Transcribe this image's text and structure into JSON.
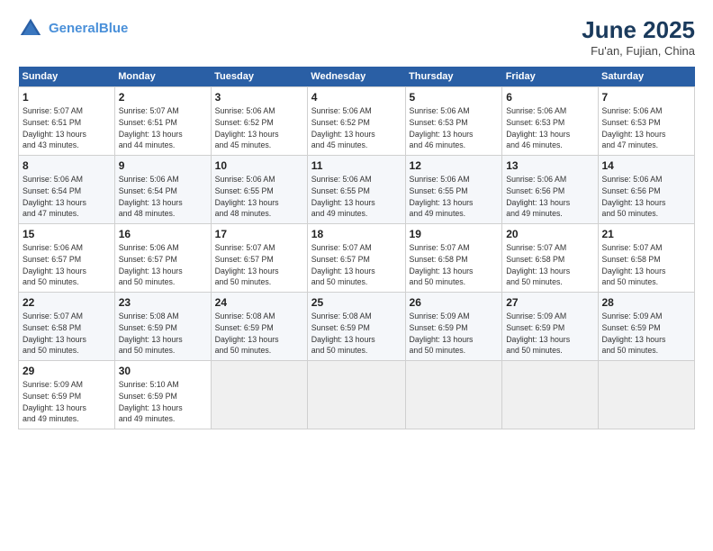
{
  "header": {
    "logo_line1": "General",
    "logo_line2": "Blue",
    "month": "June 2025",
    "location": "Fu'an, Fujian, China"
  },
  "weekdays": [
    "Sunday",
    "Monday",
    "Tuesday",
    "Wednesday",
    "Thursday",
    "Friday",
    "Saturday"
  ],
  "weeks": [
    [
      {
        "day": "1",
        "info": "Sunrise: 5:07 AM\nSunset: 6:51 PM\nDaylight: 13 hours\nand 43 minutes."
      },
      {
        "day": "2",
        "info": "Sunrise: 5:07 AM\nSunset: 6:51 PM\nDaylight: 13 hours\nand 44 minutes."
      },
      {
        "day": "3",
        "info": "Sunrise: 5:06 AM\nSunset: 6:52 PM\nDaylight: 13 hours\nand 45 minutes."
      },
      {
        "day": "4",
        "info": "Sunrise: 5:06 AM\nSunset: 6:52 PM\nDaylight: 13 hours\nand 45 minutes."
      },
      {
        "day": "5",
        "info": "Sunrise: 5:06 AM\nSunset: 6:53 PM\nDaylight: 13 hours\nand 46 minutes."
      },
      {
        "day": "6",
        "info": "Sunrise: 5:06 AM\nSunset: 6:53 PM\nDaylight: 13 hours\nand 46 minutes."
      },
      {
        "day": "7",
        "info": "Sunrise: 5:06 AM\nSunset: 6:53 PM\nDaylight: 13 hours\nand 47 minutes."
      }
    ],
    [
      {
        "day": "8",
        "info": "Sunrise: 5:06 AM\nSunset: 6:54 PM\nDaylight: 13 hours\nand 47 minutes."
      },
      {
        "day": "9",
        "info": "Sunrise: 5:06 AM\nSunset: 6:54 PM\nDaylight: 13 hours\nand 48 minutes."
      },
      {
        "day": "10",
        "info": "Sunrise: 5:06 AM\nSunset: 6:55 PM\nDaylight: 13 hours\nand 48 minutes."
      },
      {
        "day": "11",
        "info": "Sunrise: 5:06 AM\nSunset: 6:55 PM\nDaylight: 13 hours\nand 49 minutes."
      },
      {
        "day": "12",
        "info": "Sunrise: 5:06 AM\nSunset: 6:55 PM\nDaylight: 13 hours\nand 49 minutes."
      },
      {
        "day": "13",
        "info": "Sunrise: 5:06 AM\nSunset: 6:56 PM\nDaylight: 13 hours\nand 49 minutes."
      },
      {
        "day": "14",
        "info": "Sunrise: 5:06 AM\nSunset: 6:56 PM\nDaylight: 13 hours\nand 50 minutes."
      }
    ],
    [
      {
        "day": "15",
        "info": "Sunrise: 5:06 AM\nSunset: 6:57 PM\nDaylight: 13 hours\nand 50 minutes."
      },
      {
        "day": "16",
        "info": "Sunrise: 5:06 AM\nSunset: 6:57 PM\nDaylight: 13 hours\nand 50 minutes."
      },
      {
        "day": "17",
        "info": "Sunrise: 5:07 AM\nSunset: 6:57 PM\nDaylight: 13 hours\nand 50 minutes."
      },
      {
        "day": "18",
        "info": "Sunrise: 5:07 AM\nSunset: 6:57 PM\nDaylight: 13 hours\nand 50 minutes."
      },
      {
        "day": "19",
        "info": "Sunrise: 5:07 AM\nSunset: 6:58 PM\nDaylight: 13 hours\nand 50 minutes."
      },
      {
        "day": "20",
        "info": "Sunrise: 5:07 AM\nSunset: 6:58 PM\nDaylight: 13 hours\nand 50 minutes."
      },
      {
        "day": "21",
        "info": "Sunrise: 5:07 AM\nSunset: 6:58 PM\nDaylight: 13 hours\nand 50 minutes."
      }
    ],
    [
      {
        "day": "22",
        "info": "Sunrise: 5:07 AM\nSunset: 6:58 PM\nDaylight: 13 hours\nand 50 minutes."
      },
      {
        "day": "23",
        "info": "Sunrise: 5:08 AM\nSunset: 6:59 PM\nDaylight: 13 hours\nand 50 minutes."
      },
      {
        "day": "24",
        "info": "Sunrise: 5:08 AM\nSunset: 6:59 PM\nDaylight: 13 hours\nand 50 minutes."
      },
      {
        "day": "25",
        "info": "Sunrise: 5:08 AM\nSunset: 6:59 PM\nDaylight: 13 hours\nand 50 minutes."
      },
      {
        "day": "26",
        "info": "Sunrise: 5:09 AM\nSunset: 6:59 PM\nDaylight: 13 hours\nand 50 minutes."
      },
      {
        "day": "27",
        "info": "Sunrise: 5:09 AM\nSunset: 6:59 PM\nDaylight: 13 hours\nand 50 minutes."
      },
      {
        "day": "28",
        "info": "Sunrise: 5:09 AM\nSunset: 6:59 PM\nDaylight: 13 hours\nand 50 minutes."
      }
    ],
    [
      {
        "day": "29",
        "info": "Sunrise: 5:09 AM\nSunset: 6:59 PM\nDaylight: 13 hours\nand 49 minutes."
      },
      {
        "day": "30",
        "info": "Sunrise: 5:10 AM\nSunset: 6:59 PM\nDaylight: 13 hours\nand 49 minutes."
      },
      {
        "day": "",
        "info": ""
      },
      {
        "day": "",
        "info": ""
      },
      {
        "day": "",
        "info": ""
      },
      {
        "day": "",
        "info": ""
      },
      {
        "day": "",
        "info": ""
      }
    ]
  ]
}
